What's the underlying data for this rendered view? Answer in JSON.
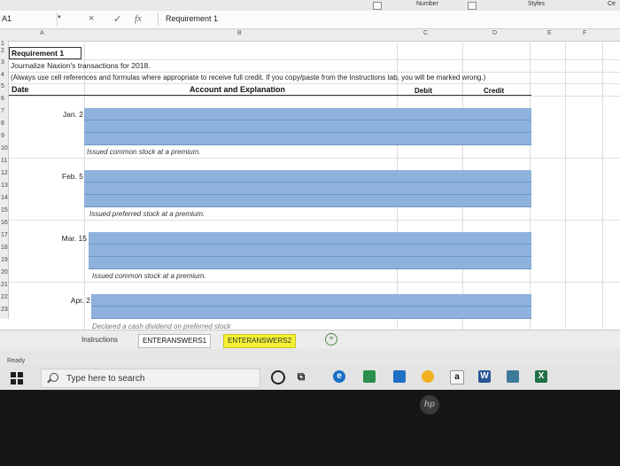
{
  "ribbon": {
    "number_label": "Number",
    "styles_label": "Styles",
    "right_clip": "Ce"
  },
  "formula_bar": {
    "name_box": "A1",
    "cancel_symbol": "×",
    "enter_symbol": "✓",
    "fx_symbol": "fx",
    "content": "Requirement 1"
  },
  "columns": [
    "A",
    "B",
    "C",
    "D",
    "E",
    "F"
  ],
  "rows": [
    "1",
    "2",
    "3",
    "4",
    "5",
    "6",
    "7",
    "8",
    "9",
    "10",
    "11",
    "12",
    "13",
    "14",
    "15",
    "16",
    "17",
    "18",
    "19",
    "20",
    "21",
    "22",
    "23"
  ],
  "sheet": {
    "title": "Requirement 1",
    "instruction": "Journalize Naxion's transactions for 2018.",
    "note": "(Always use cell references and formulas where appropriate to receive full credit. If you copy/paste from the Instructions tab, you will be marked wrong.)",
    "headers": {
      "date": "Date",
      "account": "Account and Explanation",
      "debit": "Debit",
      "credit": "Credit"
    },
    "entries": [
      {
        "date": "Jan. 2",
        "explanation": "Issued common stock at a premium."
      },
      {
        "date": "Feb. 5",
        "explanation": "Issued preferred stock at a premium."
      },
      {
        "date": "Mar. 15",
        "explanation": "Issued common stock at a premium."
      },
      {
        "date": "Apr. 2",
        "explanation": "Declared a cash dividend on preferred stock"
      }
    ]
  },
  "tabs": [
    "Instructions",
    "ENTERANSWERS1",
    "ENTERANSWERS2"
  ],
  "status": {
    "ready": "Ready"
  },
  "taskbar": {
    "search_placeholder": "Type here to search",
    "office_icon": "a",
    "word_icon": "W",
    "excel_icon": "X"
  },
  "brand": {
    "laptop_logo": "hp"
  },
  "colors": {
    "entry_fill": "#8eb2dc",
    "tab_yellow": "#f4f134",
    "taskbar": "#e3e3e3"
  }
}
